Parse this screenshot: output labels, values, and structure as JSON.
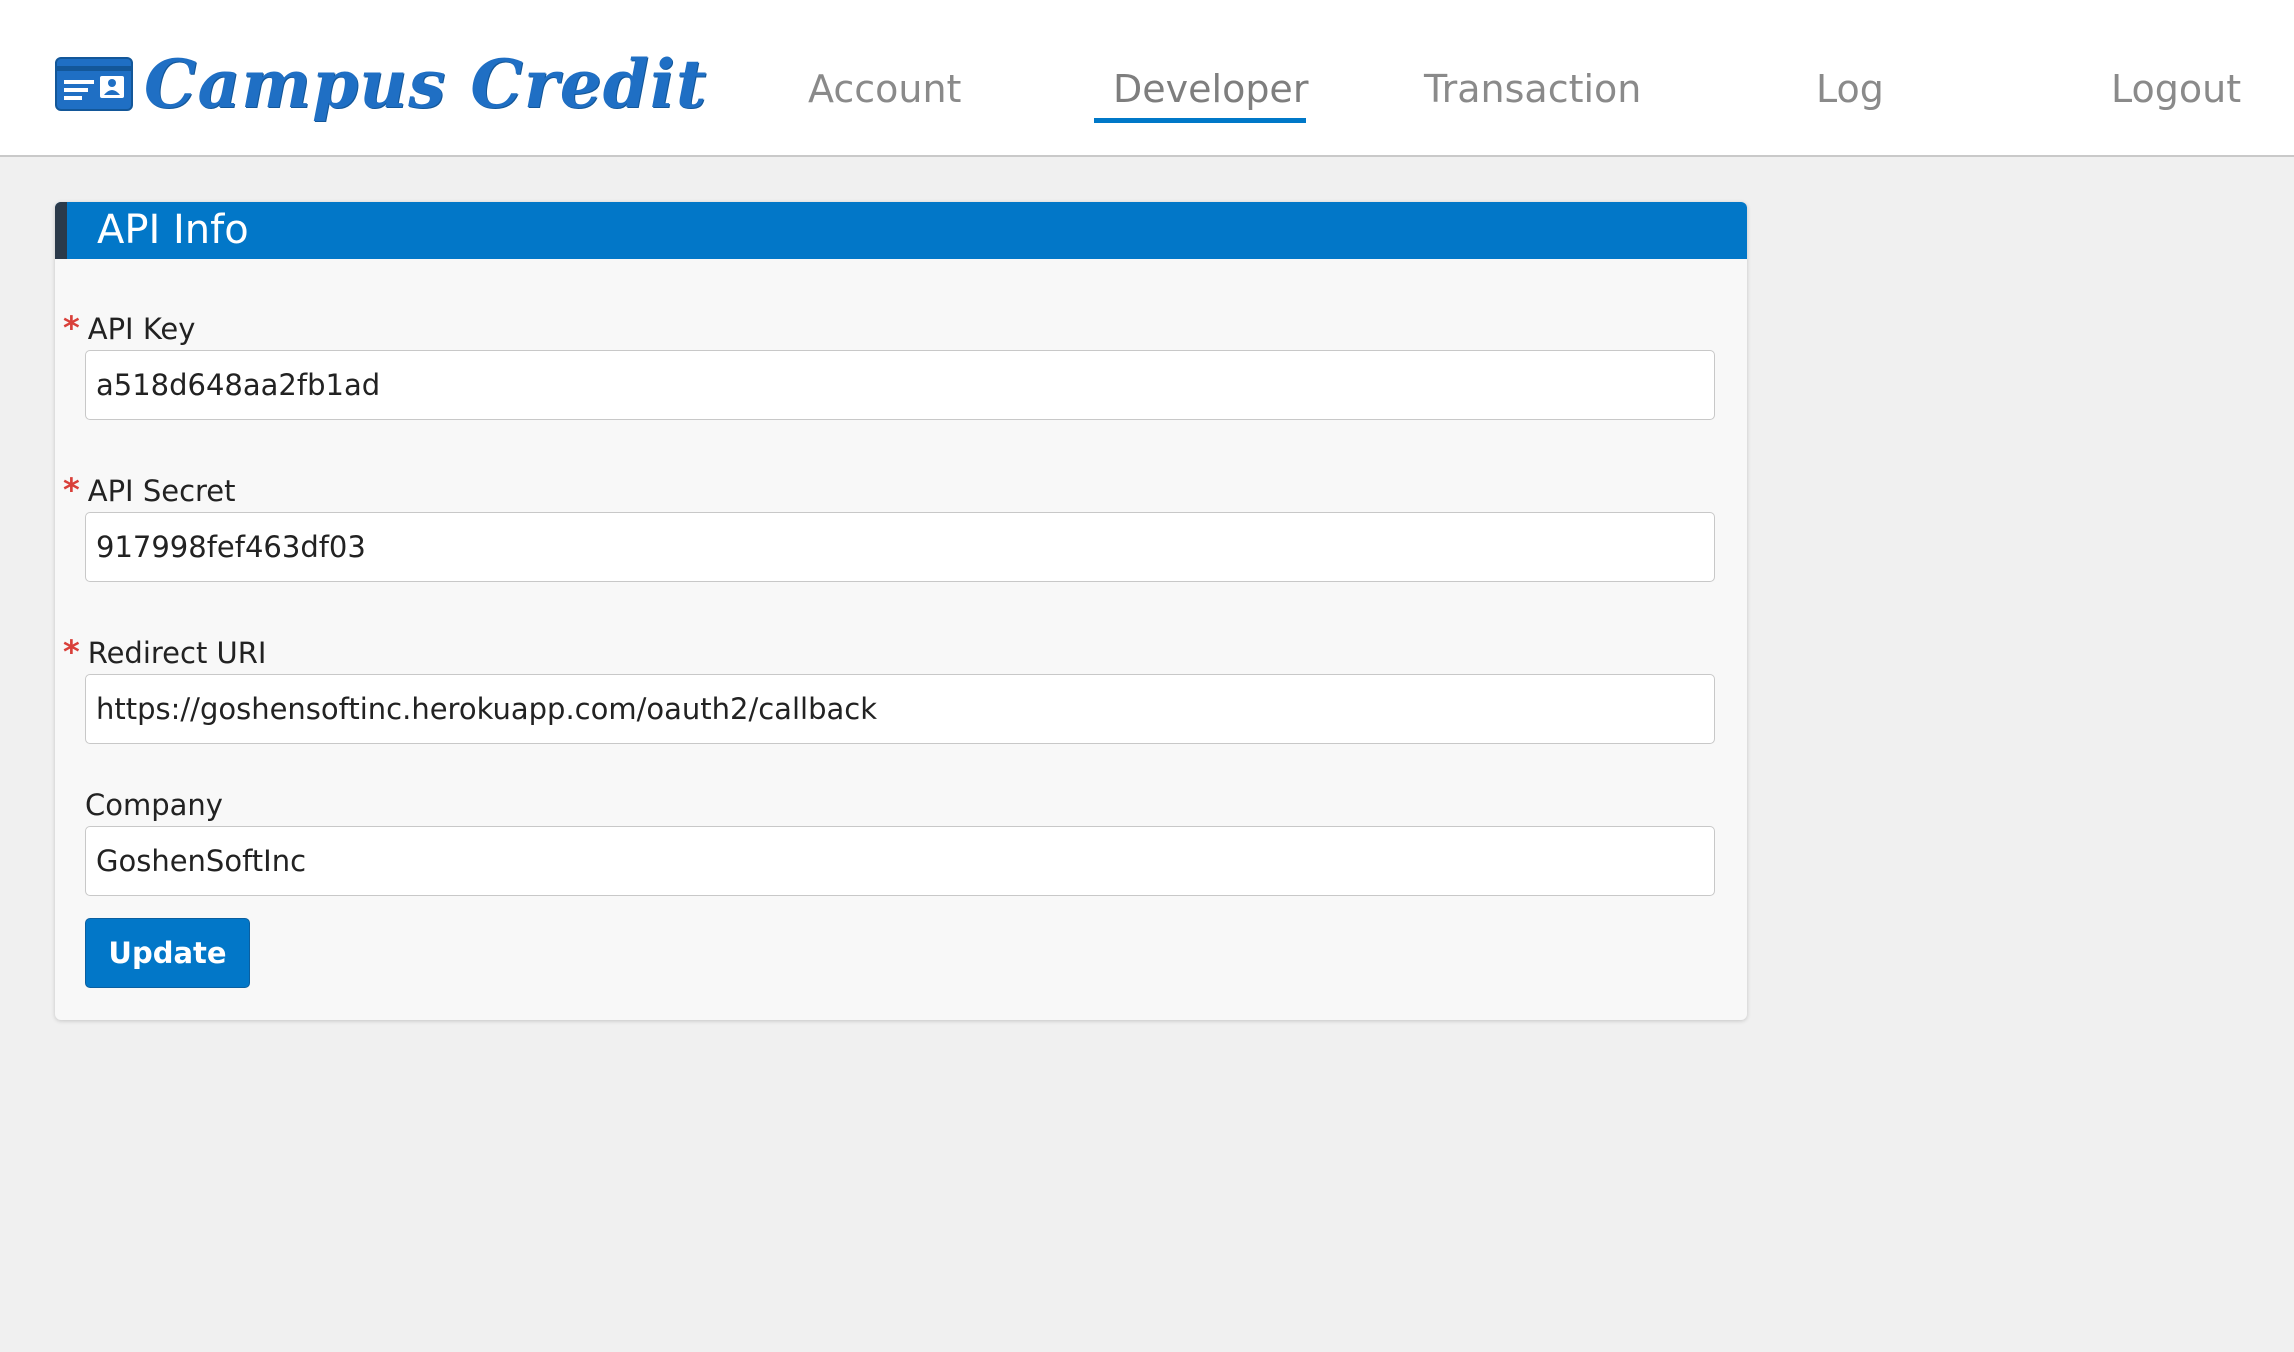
{
  "brand": {
    "name": "Campus Credit",
    "icon": "id-card-icon",
    "color": "#1f6fc4"
  },
  "nav": {
    "items": [
      {
        "label": "Account"
      },
      {
        "label": "Developer",
        "active": true
      },
      {
        "label": "Transaction"
      },
      {
        "label": "Log"
      },
      {
        "label": "Logout"
      }
    ],
    "active_color": "#0078c8"
  },
  "panel": {
    "title": "API Info",
    "header_color": "#0277c8",
    "fields": [
      {
        "label": "API Key",
        "required": true,
        "value": "a518d648aa2fb1ad"
      },
      {
        "label": "API Secret",
        "required": true,
        "value": "917998fef463df03"
      },
      {
        "label": "Redirect URI",
        "required": true,
        "value": "https://goshensoftinc.herokuapp.com/oauth2/callback"
      },
      {
        "label": "Company",
        "required": false,
        "value": "GoshenSoftInc"
      }
    ],
    "required_marker": "*",
    "required_color": "#d9403a",
    "update_label": "Update"
  }
}
